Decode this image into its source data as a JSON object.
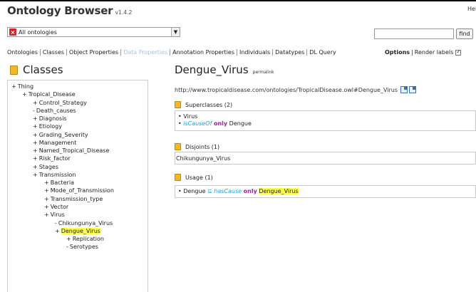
{
  "header": {
    "title": "Ontology Browser",
    "version": "v1.4.2",
    "help": "Help"
  },
  "ontology_select": {
    "value": "All ontologies"
  },
  "search": {
    "placeholder": "",
    "value": "",
    "find_label": "find"
  },
  "tabs": [
    {
      "label": "Ontologies",
      "dim": false
    },
    {
      "label": "Classes",
      "dim": false
    },
    {
      "label": "Object Properties",
      "dim": false
    },
    {
      "label": "Data Properties",
      "dim": true
    },
    {
      "label": "Annotation Properties",
      "dim": false
    },
    {
      "label": "Individuals",
      "dim": false
    },
    {
      "label": "Datatypes",
      "dim": false
    },
    {
      "label": "DL Query",
      "dim": false
    }
  ],
  "options": {
    "options_label": "Options",
    "render_labels": "Render labels",
    "render_labels_checked": true
  },
  "tree": {
    "heading": "Classes",
    "rows": [
      {
        "bullet": "+",
        "label": "Thing",
        "selected": false
      },
      {
        "bullet": "+",
        "label": "Tropical_Disease",
        "selected": false
      },
      {
        "bullet": "+",
        "label": "Control_Strategy",
        "selected": false
      },
      {
        "bullet": "-",
        "label": "Death_causes",
        "selected": false
      },
      {
        "bullet": "+",
        "label": "Diagnosis",
        "selected": false
      },
      {
        "bullet": "+",
        "label": "Etiology",
        "selected": false
      },
      {
        "bullet": "+",
        "label": "Grading_Severity",
        "selected": false
      },
      {
        "bullet": "+",
        "label": "Management",
        "selected": false
      },
      {
        "bullet": "+",
        "label": "Named_Tropical_Disease",
        "selected": false
      },
      {
        "bullet": "+",
        "label": "Risk_factor",
        "selected": false
      },
      {
        "bullet": "+",
        "label": "Stages",
        "selected": false
      },
      {
        "bullet": "+",
        "label": "Transmission",
        "selected": false
      },
      {
        "bullet": "+",
        "label": "Bacteria",
        "selected": false
      },
      {
        "bullet": "+",
        "label": "Mode_of_Transmission",
        "selected": false
      },
      {
        "bullet": "+",
        "label": "Transmission_type",
        "selected": false
      },
      {
        "bullet": "+",
        "label": "Vector",
        "selected": false
      },
      {
        "bullet": "+",
        "label": "Virus",
        "selected": false
      },
      {
        "bullet": "-",
        "label": "Chikungunya_Virus",
        "selected": false
      },
      {
        "bullet": "+",
        "label": "Dengue_Virus",
        "selected": true
      },
      {
        "bullet": "+",
        "label": "Replication",
        "selected": false
      },
      {
        "bullet": "-",
        "label": "Serotypes",
        "selected": false
      }
    ]
  },
  "entity": {
    "title": "Dengue_Virus",
    "permalink": "permalink",
    "iri": "http://www.tropicaldisease.com/ontologies/TropicalDisease.owl#Dengue_Virus"
  },
  "superclasses": {
    "heading": "Superclasses (2)",
    "row1": "Virus",
    "row2_prop": "isCauseOf",
    "row2_only": "only",
    "row2_target": "Dengue"
  },
  "disjoints": {
    "heading": "Disjoints (1)",
    "row1": "Chikungunya_Virus"
  },
  "usage": {
    "heading": "Usage (1)",
    "subject": "Dengue",
    "symbol": "⊆",
    "prop": "hasCause",
    "only": "only",
    "target": "Dengue_Virus"
  },
  "colors": {
    "class_icon": "#f1b82c",
    "property": "#1fa4d6",
    "keyword": "#a0209e",
    "highlight": "#ffff4d",
    "dim_tab": "#a9c3de"
  }
}
